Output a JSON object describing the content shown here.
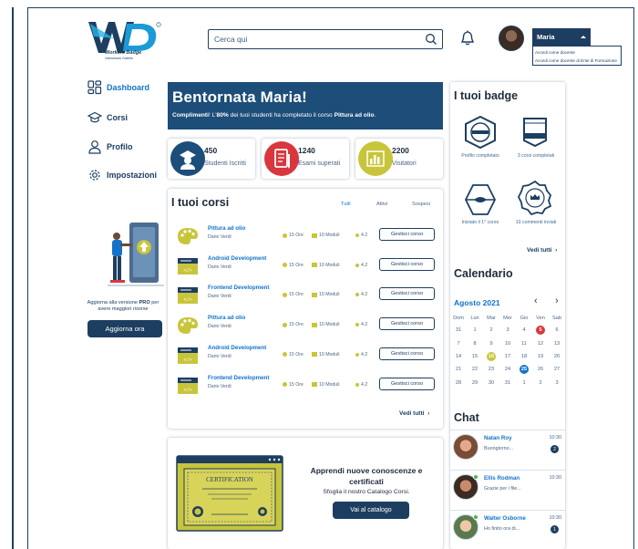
{
  "header": {
    "search_placeholder": "Cerca qui",
    "user_name": "Maria",
    "dropdown": [
      "Accedi come docente",
      "Accedi come docente di Ente di Formazione"
    ]
  },
  "logo": {
    "brand": "Workers Badge",
    "tagline": "Valorizziamo il talento"
  },
  "sidebar": {
    "items": [
      {
        "label": "Dashboard",
        "icon": "dashboard-icon",
        "active": true
      },
      {
        "label": "Corsi",
        "icon": "graduation-cap-icon",
        "active": false
      },
      {
        "label": "Profilo",
        "icon": "user-icon",
        "active": false
      },
      {
        "label": "Impostazioni",
        "icon": "gear-icon",
        "active": false
      }
    ],
    "promo": {
      "text_pre": "Aggiorna alla versione ",
      "text_bold": "PRO",
      "text_post": " per avere maggiori risorse",
      "button": "Aggiorna ora"
    }
  },
  "welcome": {
    "title": "Bentornata Maria!",
    "msg_bold1": "Complimenti",
    "msg_part1": "! L'",
    "msg_bold2": "80%",
    "msg_part2": " dei tuoi studenti ha completato il corso ",
    "msg_bold3": "Pittura ad olio",
    "msg_part3": "."
  },
  "stats": [
    {
      "value": "450",
      "label": "Studenti Iscritti",
      "color": "#1d4d79"
    },
    {
      "value": "1240",
      "label": "Esami superati",
      "color": "#d9363e"
    },
    {
      "value": "2200",
      "label": "Visitatori",
      "color": "#c8c53a"
    }
  ],
  "courses": {
    "title": "I tuoi corsi",
    "tabs": [
      "Tutti",
      "Attivi",
      "Sospesi"
    ],
    "rows": [
      {
        "title": "Pittura ad olio",
        "author": "Dario Verdi",
        "hours": "15 Ore",
        "modules": "10 Moduli",
        "rating": "4.2",
        "button": "Gestisci corso",
        "thumb": "palette"
      },
      {
        "title": "Android Development",
        "author": "Dario Verdi",
        "hours": "15 Ore",
        "modules": "10 Moduli",
        "rating": "4.2",
        "button": "Gestisci corso",
        "thumb": "code"
      },
      {
        "title": "Frontend Development",
        "author": "Dario Verdi",
        "hours": "15 Ore",
        "modules": "10 Moduli",
        "rating": "4.2",
        "button": "Gestisci corso",
        "thumb": "code"
      },
      {
        "title": "Pittura ad olio",
        "author": "Dario Verdi",
        "hours": "15 Ore",
        "modules": "10 Moduli",
        "rating": "4.2",
        "button": "Gestisci corso",
        "thumb": "palette"
      },
      {
        "title": "Android Development",
        "author": "Dario Verdi",
        "hours": "15 Ore",
        "modules": "10 Moduli",
        "rating": "4.2",
        "button": "Gestisci corso",
        "thumb": "code"
      },
      {
        "title": "Frontend Development",
        "author": "Dario Verdi",
        "hours": "15 Ore",
        "modules": "10 Moduli",
        "rating": "4.2",
        "button": "Gestisci corso",
        "thumb": "code"
      }
    ],
    "see_all": "Vedi tutti"
  },
  "catalog": {
    "cert_word": "CERTIFICATION",
    "title": "Apprendi nuove conoscenze e certificati",
    "subtitle": "Sfoglia il nostro Catalogo Corsi.",
    "button": "Vai al catalogo"
  },
  "badges": {
    "title": "I tuoi badge",
    "items": [
      {
        "label": "Profilo completato",
        "icon": "profile-badge-icon"
      },
      {
        "label": "3 corsi completati",
        "icon": "courses-badge-icon"
      },
      {
        "label": "Iniziato il 1° corso",
        "icon": "started-badge-icon"
      },
      {
        "label": "10 commenti inviati",
        "icon": "comments-badge-icon"
      }
    ],
    "see_all": "Vedi tutti"
  },
  "calendar": {
    "title": "Calendario",
    "month": "Agosto 2021",
    "weekdays": [
      "Dom",
      "Lun",
      "Mar",
      "Mer",
      "Gio",
      "Ven",
      "Sab"
    ],
    "weeks": [
      [
        "31",
        "1",
        "2",
        "3",
        "4",
        "5",
        "6"
      ],
      [
        "7",
        "8",
        "9",
        "10",
        "11",
        "12",
        "13"
      ],
      [
        "14",
        "15",
        "16",
        "17",
        "18",
        "19",
        "20"
      ],
      [
        "21",
        "22",
        "23",
        "24",
        "25",
        "26",
        "27"
      ],
      [
        "28",
        "29",
        "30",
        "31",
        "1",
        "2",
        "3"
      ]
    ],
    "highlights": {
      "5": "#d9363e",
      "16": "#c8c53a",
      "25": "#1473c9"
    }
  },
  "chat": {
    "title": "Chat",
    "items": [
      {
        "name": "Natan Roy",
        "msg": "Buongiorno...",
        "time": "10:30",
        "count": "2",
        "online": false
      },
      {
        "name": "Ellis Rodman",
        "msg": "Grazie per i file...",
        "time": "10:30",
        "count": "",
        "online": true
      },
      {
        "name": "Walter Osborne",
        "msg": "Ho finito ora di...",
        "time": "10:30",
        "count": "1",
        "online": true
      }
    ]
  }
}
